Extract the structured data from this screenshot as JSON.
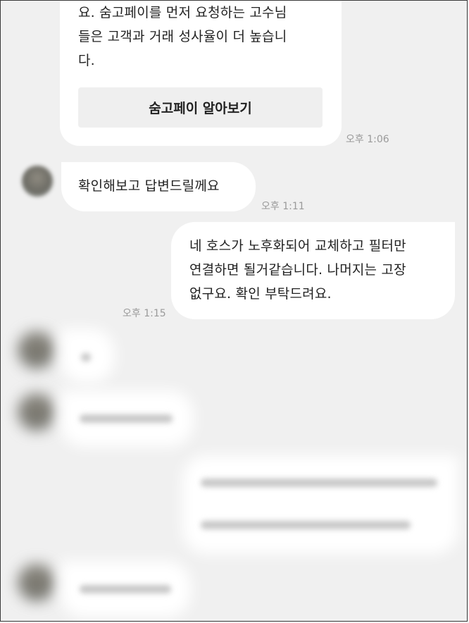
{
  "messages": {
    "m1": {
      "text": "요. 숨고페이를 먼저 요청하는 고수님\n들은 고객과 거래 성사율이 더 높습니\n다.",
      "cta_label": "숨고페이 알아보기",
      "time": "오후 1:06"
    },
    "m2": {
      "text": "확인해보고 답변드릴께요",
      "time": "오후 1:11"
    },
    "m3": {
      "text": "네 호스가 노후화되어 교체하고 필터만\n연결하면 될거같습니다. 나머지는 고장\n없구요. 확인 부탁드려요.",
      "time": "오후 1:15"
    }
  },
  "colors": {
    "background": "#f0f0f0",
    "bubble": "#ffffff",
    "time_text": "#9a9a9a",
    "cta_background": "#efefef"
  }
}
